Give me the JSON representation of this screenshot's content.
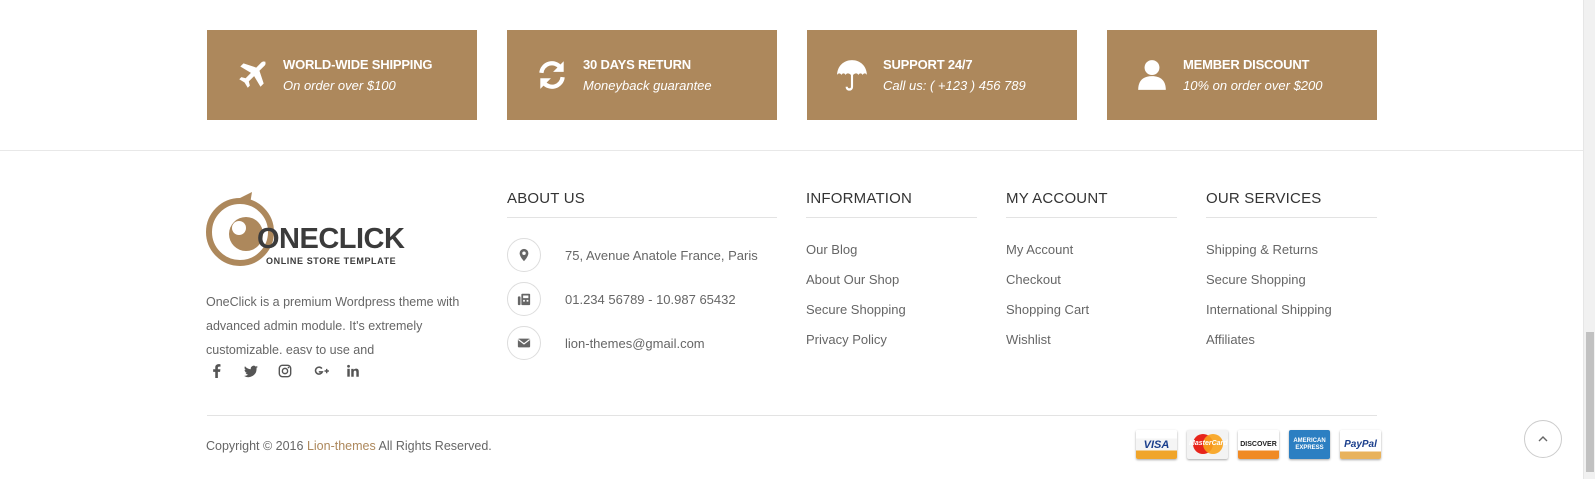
{
  "services": [
    {
      "icon": "airplane-icon",
      "title": "WORLD-WIDE SHIPPING",
      "subtitle": "On order over $100"
    },
    {
      "icon": "refresh-icon",
      "title": "30 DAYS RETURN",
      "subtitle": "Moneyback guarantee"
    },
    {
      "icon": "umbrella-icon",
      "title": "SUPPORT 24/7",
      "subtitle": "Call us: ( +123 ) 456 789"
    },
    {
      "icon": "user-icon",
      "title": "MEMBER DISCOUNT",
      "subtitle": "10% on order over $200"
    }
  ],
  "logo": {
    "brand": "ONECLICK",
    "tagline": "ONLINE STORE TEMPLATE"
  },
  "about_text": "OneClick is a premium Wordpress theme with advanced admin module. It's extremely customizable, easy to use and",
  "social": [
    "facebook-icon",
    "twitter-icon",
    "instagram-icon",
    "google-plus-icon",
    "linkedin-icon"
  ],
  "about_us": {
    "title": "ABOUT US",
    "address": "75, Avenue Anatole France, Paris",
    "phone": "01.234 56789 - 10.987 65432",
    "email": "lion-themes@gmail.com"
  },
  "information": {
    "title": "INFORMATION",
    "links": [
      "Our Blog",
      "About Our Shop",
      "Secure Shopping",
      "Privacy Policy"
    ]
  },
  "my_account": {
    "title": "MY ACCOUNT",
    "links": [
      "My Account",
      "Checkout",
      "Shopping Cart",
      "Wishlist"
    ]
  },
  "our_services": {
    "title": "OUR SERVICES",
    "links": [
      "Shipping & Returns",
      "Secure Shopping",
      "International Shipping",
      "Affiliates"
    ]
  },
  "copyright": {
    "prefix": "Copyright © 2016 ",
    "link": "Lion-themes",
    "suffix": " All Rights Reserved."
  },
  "payments": {
    "visa": "VISA",
    "mastercard": "MasterCard",
    "discover": "DISCOVER",
    "amex": "AMERICAN EXPRESS",
    "paypal": "PayPal"
  },
  "colors": {
    "accent": "#ad885c",
    "text": "#666666",
    "heading": "#333333"
  }
}
